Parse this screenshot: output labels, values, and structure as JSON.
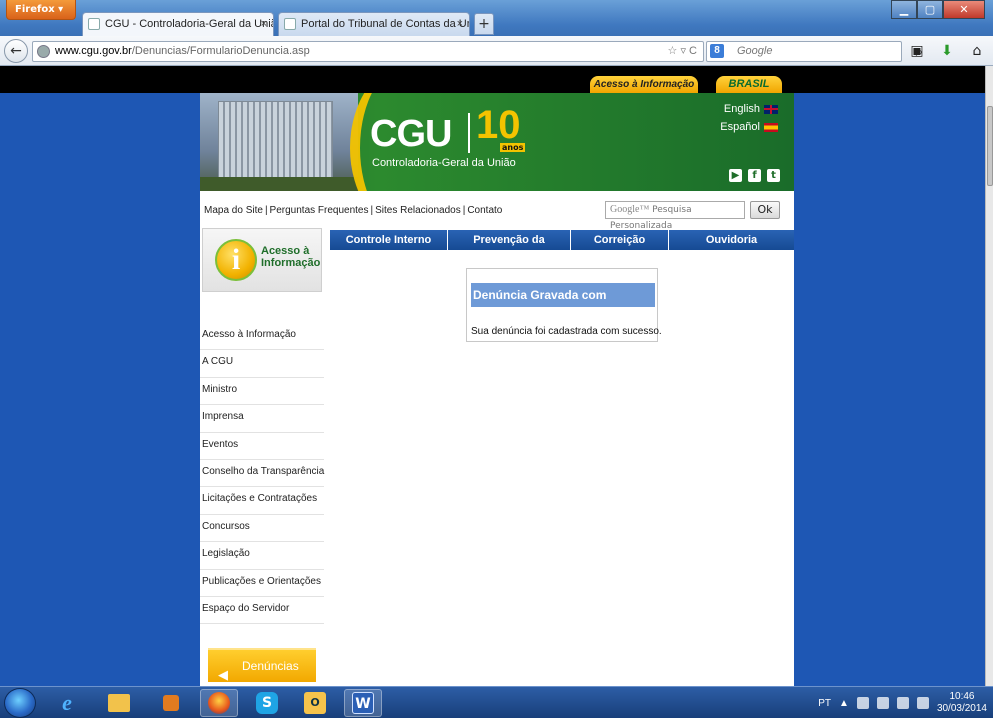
{
  "browser": {
    "menu_label": "Firefox ▾",
    "tabs": [
      {
        "title": "CGU - Controladoria-Geral da União",
        "close": "×"
      },
      {
        "title": "Portal do Tribunal de Contas da União",
        "close": "×"
      }
    ],
    "new_tab": "+",
    "url_host": "www.cgu.gov.br",
    "url_path": "/Denuncias/FormularioDenuncia.asp",
    "url_controls": "☆ ▿ C",
    "search_placeholder": "Google",
    "search_engine_letter": "8"
  },
  "page": {
    "top_pills": {
      "acesso": "Acesso à Informação",
      "brasil": "BRASIL"
    },
    "banner": {
      "logo": "CGU",
      "logo_number": "10",
      "logo_anos": "anos",
      "subtitle": "Controladoria-Geral da União",
      "lang_english": "English",
      "lang_espanol": "Español",
      "social": [
        "▶",
        "f",
        "t"
      ]
    },
    "top_links": [
      "Mapa do Site",
      "Perguntas Frequentes",
      "Sites Relacionados",
      "Contato"
    ],
    "top_links_sep": "|",
    "search": {
      "brand": "Google™",
      "placeholder": "Pesquisa Personalizada",
      "button": "Ok"
    },
    "acesso_box": {
      "icon_letter": "i",
      "label": "Acesso à Informação"
    },
    "left_nav": [
      "Acesso à Informação",
      "A CGU",
      "Ministro",
      "Imprensa",
      "Eventos",
      "Conselho da Transparência",
      "Licitações e Contratações",
      "Concursos",
      "Legislação",
      "Publicações e Orientações",
      "Espaço do Servidor"
    ],
    "denuncias_button": "Denúncias",
    "menu_tabs": [
      "Controle Interno",
      "Prevenção da Corrupção",
      "Correição",
      "Ouvidoria"
    ],
    "message": {
      "title": "Denúncia Gravada com sucesso",
      "text": "Sua denúncia foi cadastrada com sucesso."
    }
  },
  "taskbar": {
    "word_letter": "W",
    "skype_letter": "S",
    "outlook_letter": "O",
    "ie_letter": "e",
    "tray_lang": "PT",
    "time": "10:46",
    "date": "30/03/2014"
  }
}
